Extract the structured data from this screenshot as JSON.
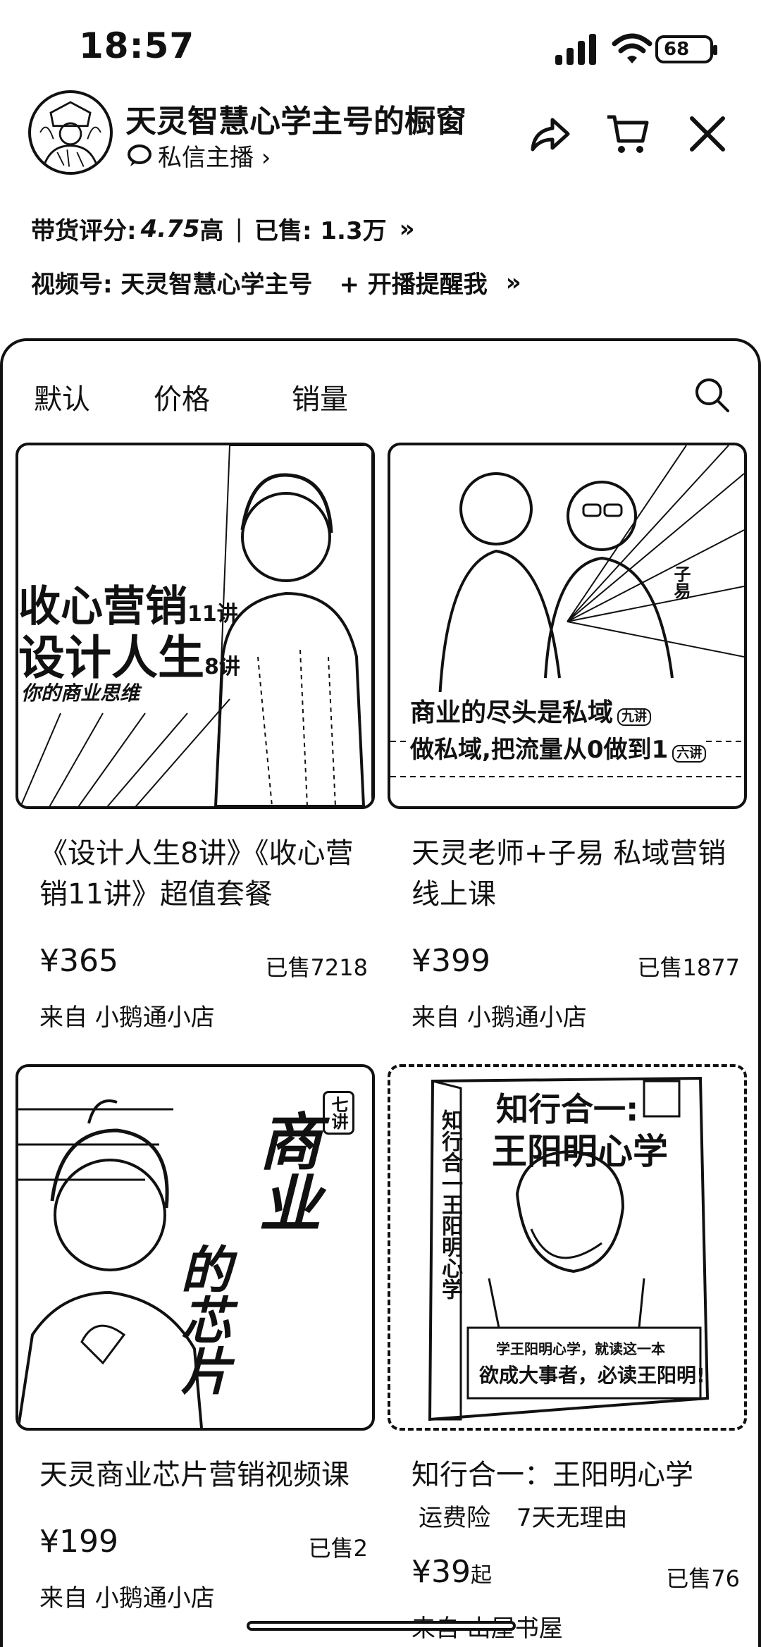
{
  "status": {
    "time": "18:57",
    "battery": "68"
  },
  "header": {
    "shop_title": "天灵智慧心学主号的橱窗",
    "message_link": "私信主播 ›",
    "rating_label": "带货评分:",
    "rating_value": "4.75",
    "rating_level": "高",
    "sold_label": "已售: 1.3万",
    "channel": "视频号: 天灵智慧心学主号",
    "remind": "+ 开播提醒我",
    "chevron": "»"
  },
  "tabs": [
    "默认",
    "价格",
    "销量"
  ],
  "products": [
    {
      "title": "《设计人生8讲》《收心营销11讲》超值套餐",
      "price": "¥365",
      "price_suffix": "",
      "sold": "已售7218",
      "from": "来自 小鹅通小店",
      "art": {
        "line1": "收心营销",
        "line1_sup": "11讲",
        "line2": "设计人生",
        "line2_sup": "8讲",
        "line3": "你的商业思维"
      }
    },
    {
      "title": "天灵老师+子易 私域营销线上课",
      "price": "¥399",
      "price_suffix": "",
      "sold": "已售1877",
      "from": "来自 小鹅通小店",
      "art": {
        "line1": "商业的尽头是私域",
        "line1_sup": "九讲",
        "line2": "做私域,把流量从0做到1",
        "line2_sup": "六讲",
        "tag": "子易"
      }
    },
    {
      "title": "天灵商业芯片营销视频课",
      "price": "¥199",
      "price_suffix": "",
      "sold": "已售2",
      "from": "来自 小鹅通小店",
      "art": {
        "badge": "七讲",
        "v1": "商业",
        "v2": "的芯片"
      }
    },
    {
      "title": "知行合一：王阳明心学",
      "price": "¥39",
      "price_suffix": "起",
      "sold": "已售76",
      "from": "来自 山屋书屋",
      "tags": [
        "运费险",
        "7天无理由"
      ],
      "art": {
        "t1": "知行合一:",
        "t2": "王阳明心学",
        "spine": "知行合一王阳明心学",
        "b1": "学王阳明心学，就读这一本",
        "b2": "欲成大事者，必读王阳明!"
      }
    }
  ]
}
